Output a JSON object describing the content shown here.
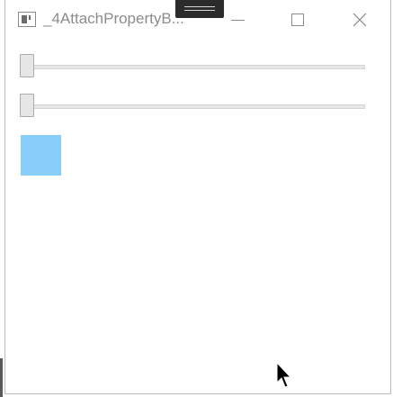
{
  "window": {
    "title": "_4AttachPropertyB...",
    "minimize_icon": "minimize-icon",
    "maximize_icon": "maximize-icon",
    "close_icon": "close-icon"
  },
  "content": {
    "slider_1": {
      "value": 0.0
    },
    "slider_2": {
      "value": 0.0
    },
    "swatch": {
      "color": "#87cefa"
    }
  }
}
